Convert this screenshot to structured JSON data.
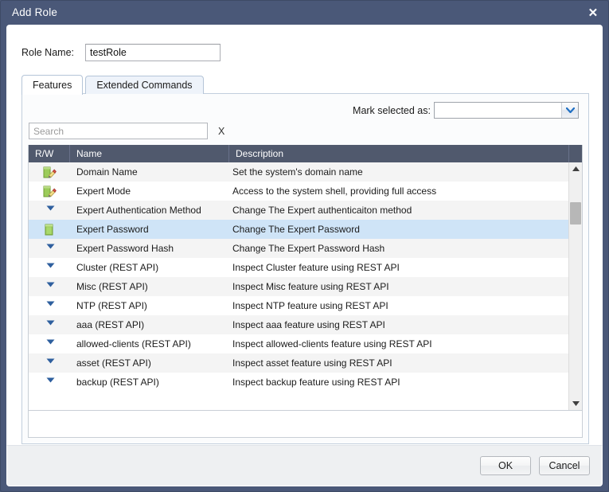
{
  "window": {
    "title": "Add Role",
    "close_icon": "close-icon"
  },
  "form": {
    "role_name_label": "Role Name:",
    "role_name_value": "testRole",
    "role_name_placeholder": ""
  },
  "tabs": [
    {
      "label": "Features",
      "active": true
    },
    {
      "label": "Extended Commands",
      "active": false
    }
  ],
  "toolbar": {
    "mark_label": "Mark selected as:",
    "mark_value": "",
    "mark_dropdown_icon": "chevron-down-icon",
    "search_placeholder": "Search",
    "search_value": "",
    "search_clear_label": "X"
  },
  "grid": {
    "columns": [
      "R/W",
      "Name",
      "Description"
    ],
    "rows": [
      {
        "icon": "notepad-pencil-icon",
        "name": "Domain Name",
        "description": "Set the system's domain name",
        "selected": false
      },
      {
        "icon": "notepad-pencil-icon",
        "name": "Expert Mode",
        "description": "Access to the system shell, providing full access",
        "selected": false
      },
      {
        "icon": "triangle-down-icon",
        "name": "Expert Authentication Method",
        "description": "Change The Expert authenticaiton method",
        "selected": false
      },
      {
        "icon": "notepad-icon",
        "name": "Expert Password",
        "description": "Change The Expert Password",
        "selected": true
      },
      {
        "icon": "triangle-down-icon",
        "name": "Expert Password Hash",
        "description": "Change The Expert Password Hash",
        "selected": false
      },
      {
        "icon": "triangle-down-icon",
        "name": "Cluster (REST API)",
        "description": "Inspect Cluster feature using REST API",
        "selected": false
      },
      {
        "icon": "triangle-down-icon",
        "name": "Misc (REST API)",
        "description": "Inspect Misc feature using REST API",
        "selected": false
      },
      {
        "icon": "triangle-down-icon",
        "name": "NTP (REST API)",
        "description": "Inspect NTP feature using REST API",
        "selected": false
      },
      {
        "icon": "triangle-down-icon",
        "name": "aaa (REST API)",
        "description": "Inspect aaa feature using REST API",
        "selected": false
      },
      {
        "icon": "triangle-down-icon",
        "name": "allowed-clients (REST API)",
        "description": "Inspect allowed-clients feature using REST API",
        "selected": false
      },
      {
        "icon": "triangle-down-icon",
        "name": "asset (REST API)",
        "description": "Inspect asset feature using REST API",
        "selected": false
      },
      {
        "icon": "triangle-down-icon",
        "name": "backup (REST API)",
        "description": "Inspect backup feature using REST API",
        "selected": false
      }
    ],
    "scrollbar": {
      "up_icon": "scroll-up-icon",
      "down_icon": "scroll-down-icon"
    }
  },
  "footer": {
    "ok_label": "OK",
    "cancel_label": "Cancel"
  },
  "colors": {
    "titlebar": "#4a5878",
    "grid_header": "#50596d",
    "selection": "#cfe4f7",
    "accent": "#1f6fc4"
  }
}
